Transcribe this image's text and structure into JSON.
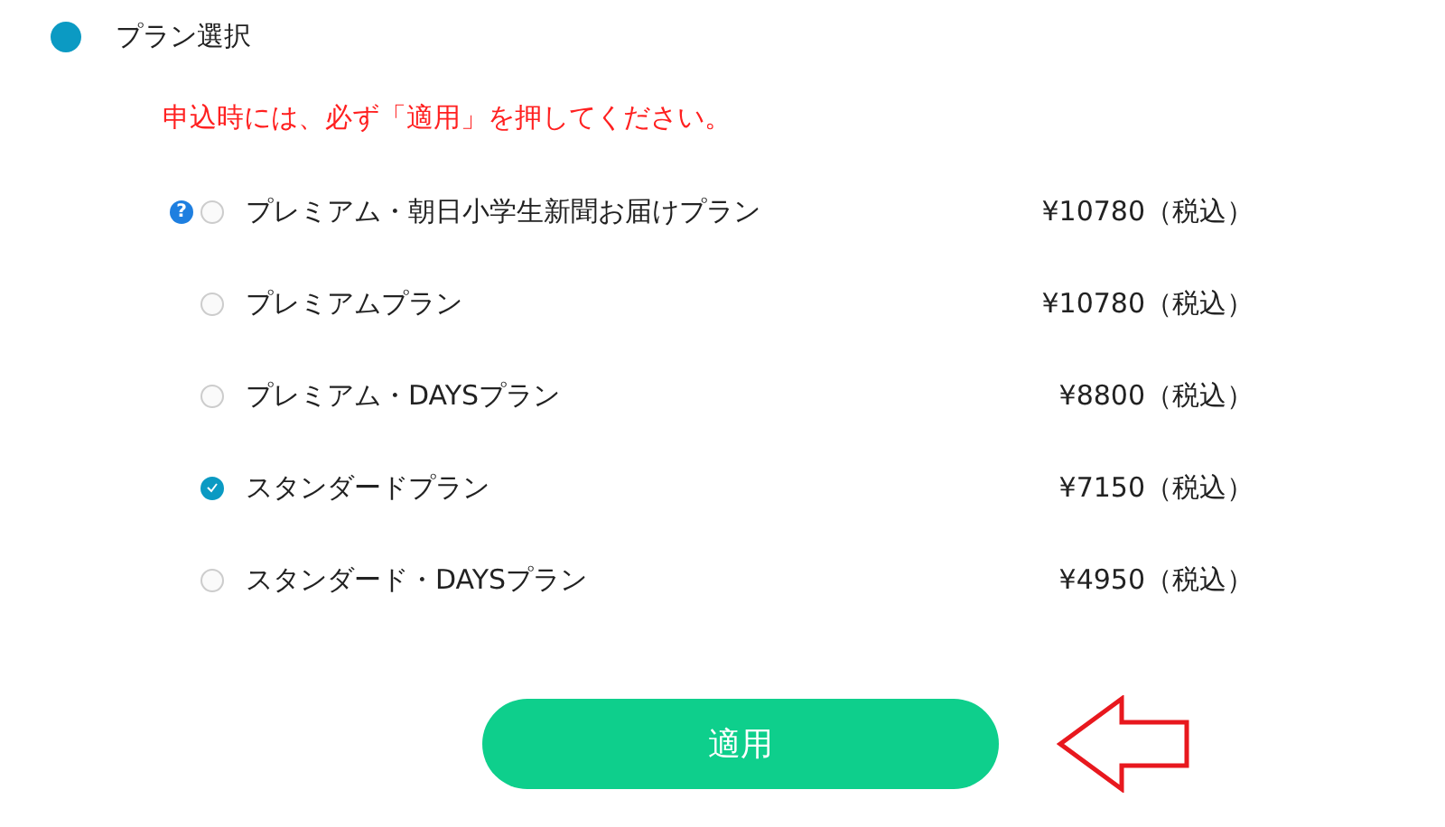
{
  "section": {
    "title": "プラン選択"
  },
  "notice": "申込時には、必ず「適用」を押してください。",
  "plans": [
    {
      "help_icon": "?",
      "name": "プレミアム・朝日小学生新聞お届けプラン",
      "price": "¥10780（税込）",
      "selected": false
    },
    {
      "name": "プレミアムプラン",
      "price": "¥10780（税込）",
      "selected": false
    },
    {
      "name": "プレミアム・DAYSプラン",
      "price": "¥8800（税込）",
      "selected": false
    },
    {
      "name": "スタンダードプラン",
      "price": "¥7150（税込）",
      "selected": true
    },
    {
      "name": "スタンダード・DAYSプラン",
      "price": "¥4950（税込）",
      "selected": false
    }
  ],
  "apply_button": "適用"
}
